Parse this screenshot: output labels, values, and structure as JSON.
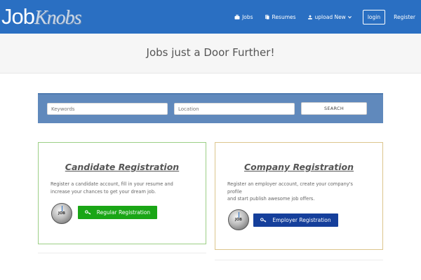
{
  "logo": {
    "part1": "Job",
    "part2": "Knobs"
  },
  "nav": {
    "jobs": "Jobs",
    "resumes": "Resumes",
    "upload": "upload New",
    "login": "login",
    "register": "Register"
  },
  "hero": {
    "title": "Jobs just a Door Further!"
  },
  "search": {
    "keywords_placeholder": "Keywords",
    "location_placeholder": "Location",
    "button": "SEARCH"
  },
  "candidate": {
    "title": "Candidate Registration",
    "text_line1": "Register a candidate account, fill in your resume and",
    "text_line2": "increase your chances to get your dream job.",
    "badge": "JOB",
    "button": "Regular Registration"
  },
  "company": {
    "title": "Company Registration",
    "text_line1": "Register an employer account, create your company's",
    "text_line2": "profile",
    "text_line3": "and start publish awesome job offers.",
    "badge": "JOB",
    "button": "Employer Registration"
  },
  "colors": {
    "header": "#2a6fc2",
    "search_band": "#6089bc",
    "green_button": "#1aa616",
    "blue_button": "#153f9b",
    "candidate_border": "#9ccf86",
    "company_border": "#dcc58d"
  },
  "icons": {
    "jobs": "briefcase-icon",
    "resumes": "document-icon",
    "upload": "upload-icon",
    "dropdown": "chevron-down-icon",
    "register_button": "key-icon"
  }
}
